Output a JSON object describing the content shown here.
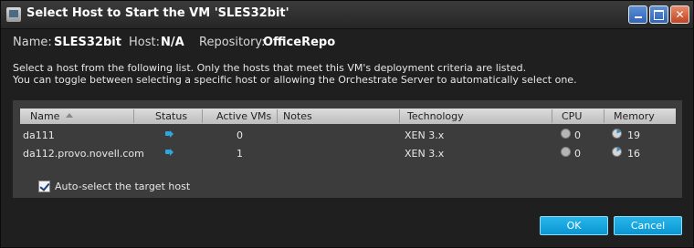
{
  "window": {
    "title": "Select Host to Start the VM 'SLES32bit'"
  },
  "info": {
    "name_label": "Name:",
    "name_value": "SLES32bit",
    "host_label": "Host:",
    "host_value": "N/A",
    "repo_label": "Repository:",
    "repo_value": "OfficeRepo"
  },
  "description": {
    "line1": "Select a host from the following list. Only the hosts that meet this VM's deployment criteria are listed.",
    "line2": "You can toggle between selecting a specific host or allowing the Orchestrate Server to automatically select one."
  },
  "table": {
    "columns": [
      "Name",
      "Status",
      "Active VMs",
      "Notes",
      "Technology",
      "CPU",
      "Memory"
    ],
    "sort": "ascending",
    "rows": [
      {
        "name": "da111",
        "status": "running",
        "active_vms": "0",
        "notes": "",
        "technology": "XEN 3.x",
        "cpu": "0",
        "memory": "19",
        "memory_fraction": 0.19
      },
      {
        "name": "da112.provo.novell.com",
        "status": "running",
        "active_vms": "1",
        "notes": "",
        "technology": "XEN 3.x",
        "cpu": "0",
        "memory": "16",
        "memory_fraction": 0.16
      }
    ]
  },
  "auto_select": {
    "label": "Auto-select the target host",
    "checked": true
  },
  "buttons": {
    "ok": "OK",
    "cancel": "Cancel"
  },
  "colors": {
    "accent": "#1aa7e0",
    "status_icon": "#2ea6df",
    "memory_fill": "#2e8fd0"
  }
}
